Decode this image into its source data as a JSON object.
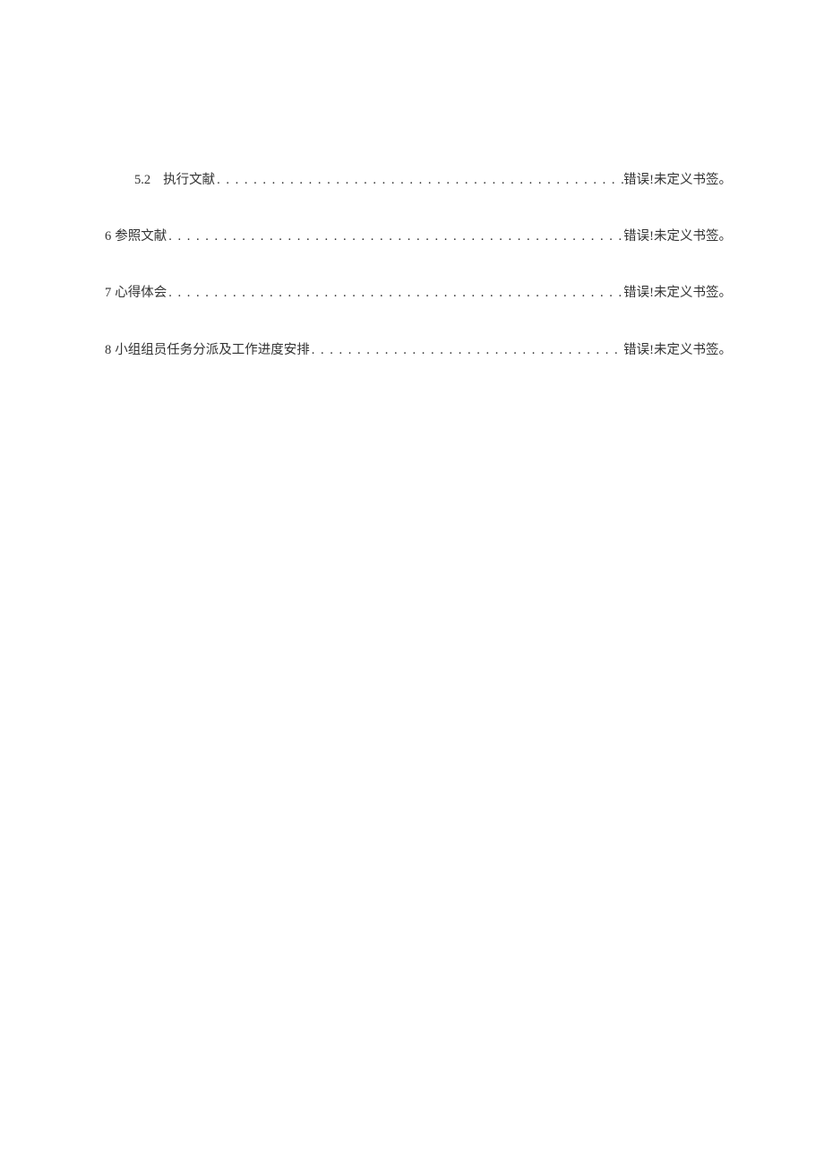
{
  "toc": {
    "entries": [
      {
        "number": "5.2",
        "title": "执行文献",
        "page": "错误!未定义书签。",
        "indent": true
      },
      {
        "number": "6",
        "title": "参照文献",
        "page": "错误!未定义书签。",
        "indent": false
      },
      {
        "number": "7",
        "title": "心得体会",
        "page": "错误!未定义书签。",
        "indent": false
      },
      {
        "number": "8",
        "title": "小组组员任务分派及工作进度安排",
        "page": "错误!未定义书签。",
        "indent": false
      }
    ]
  }
}
